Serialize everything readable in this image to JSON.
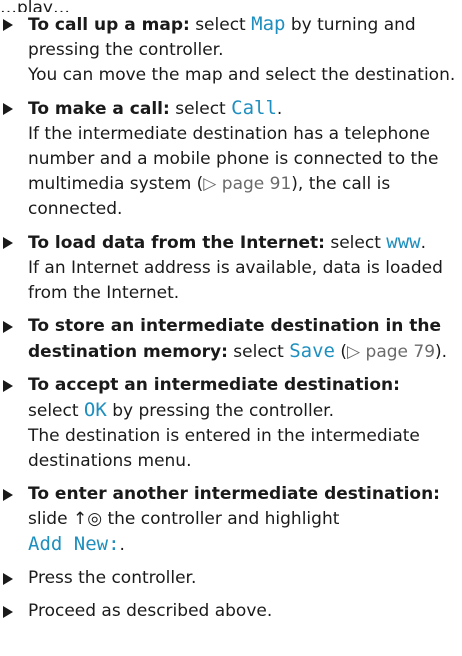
{
  "top_fragment": "…play…",
  "items": [
    {
      "bold": "To call up a map:",
      "t1": " select ",
      "ui1": "Map",
      "t2": " by turning and pressing the controller.",
      "extra": "You can move the map and select the destination."
    },
    {
      "bold": "To make a call:",
      "t1": " select ",
      "ui1": "Call",
      "t2": ".",
      "extra_a": "If the intermediate destination has a telephone number and a mobile phone is connected to the multimedia system (",
      "page_ref": "▷ page 91",
      "extra_b": "), the call is connected."
    },
    {
      "bold": "To load data from the Internet:",
      "t1": " select ",
      "ui1": "www",
      "t2": ".",
      "extra": "If an Internet address is available, data is loaded from the Internet."
    },
    {
      "bold": "To store an intermediate destination in the destination memory:",
      "t1": " select ",
      "ui1": "Save",
      "t2a": " (",
      "page_ref": "▷ page 79",
      "t2b": ")."
    },
    {
      "bold": "To accept an intermediate destination:",
      "t1": " select ",
      "ui1": "OK",
      "t2": " by pressing the controller.",
      "extra": "The destination is entered in the intermediate destinations menu."
    },
    {
      "bold": "To enter another intermediate destination:",
      "t1": " slide ",
      "control": "↑◎",
      "t2": " the controller and highlight ",
      "ui1": "Add New:",
      "t3": "."
    },
    {
      "text": "Press the controller."
    },
    {
      "text": "Proceed as described above."
    }
  ],
  "colors": {
    "ui_text": "#1e8fbf",
    "bullet": "#1a1a1a"
  },
  "icons": {
    "bullet": "right-triangle-icon",
    "controller": "controller-slide-up-icon"
  }
}
